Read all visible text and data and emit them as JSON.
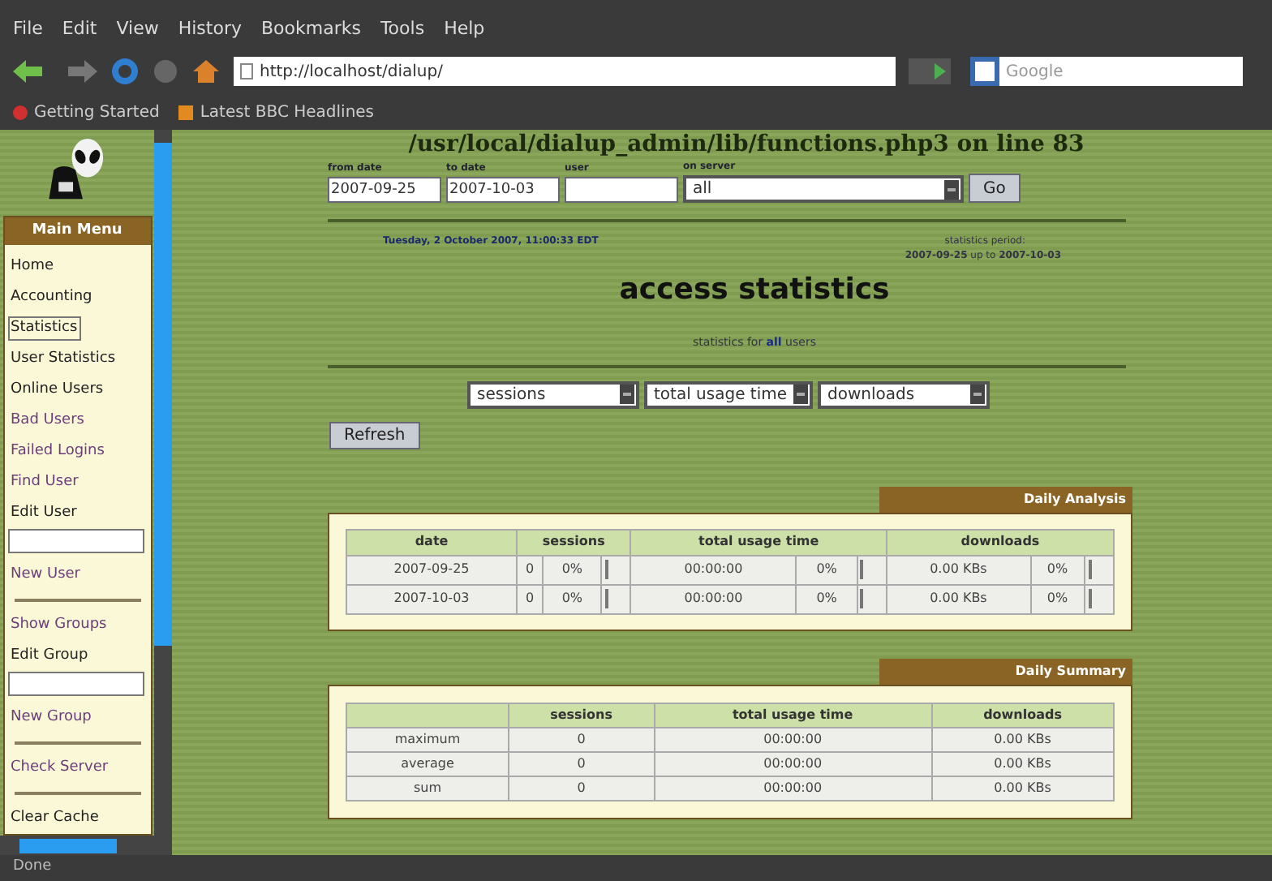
{
  "menu_bar": [
    "File",
    "Edit",
    "View",
    "History",
    "Bookmarks",
    "Tools",
    "Help"
  ],
  "address_bar": {
    "value": "http://localhost/dialup/"
  },
  "search_field": {
    "placeholder": "Google"
  },
  "bookmarks": [
    "Getting Started",
    "Latest BBC Headlines"
  ],
  "sidebar": {
    "title": "Main Menu",
    "items": [
      {
        "label": "Home",
        "kind": "link",
        "visited": false,
        "selected": false,
        "separator_after": false
      },
      {
        "label": "Accounting",
        "kind": "link",
        "visited": false,
        "selected": false,
        "separator_after": false
      },
      {
        "label": "Statistics",
        "kind": "link",
        "visited": false,
        "selected": true,
        "separator_after": false
      },
      {
        "label": "User Statistics",
        "kind": "link",
        "visited": false,
        "selected": false,
        "separator_after": false
      },
      {
        "label": "Online Users",
        "kind": "link",
        "visited": false,
        "selected": false,
        "separator_after": false
      },
      {
        "label": "Bad Users",
        "kind": "link",
        "visited": true,
        "selected": false,
        "separator_after": false
      },
      {
        "label": "Failed Logins",
        "kind": "link",
        "visited": true,
        "selected": false,
        "separator_after": false
      },
      {
        "label": "Find User",
        "kind": "link",
        "visited": true,
        "selected": false,
        "separator_after": false
      },
      {
        "label": "Edit User",
        "kind": "field",
        "visited": false,
        "selected": false,
        "separator_after": false
      },
      {
        "label": "New User",
        "kind": "link",
        "visited": true,
        "selected": false,
        "separator_after": true
      },
      {
        "label": "Show Groups",
        "kind": "link",
        "visited": true,
        "selected": false,
        "separator_after": false
      },
      {
        "label": "Edit Group",
        "kind": "field",
        "visited": false,
        "selected": false,
        "separator_after": false
      },
      {
        "label": "New Group",
        "kind": "link",
        "visited": true,
        "selected": false,
        "separator_after": true
      },
      {
        "label": "Check Server",
        "kind": "link",
        "visited": true,
        "selected": false,
        "separator_after": true
      },
      {
        "label": "Clear Cache",
        "kind": "link",
        "visited": false,
        "selected": false,
        "separator_after": false
      }
    ]
  },
  "error_line": "/usr/local/dialup_admin/lib/functions.php3 on line **83**",
  "filter_form": {
    "fields": [
      {
        "label": "from date",
        "kind": "text",
        "value": "2007-09-25"
      },
      {
        "label": "to date",
        "kind": "text",
        "value": "2007-10-03"
      },
      {
        "label": "user",
        "kind": "text"
      },
      {
        "label": "on server",
        "kind": "select",
        "value": "all"
      }
    ],
    "button": "Go"
  },
  "timestamp": "Tuesday, 2 October 2007, 11:00:33 EDT",
  "period": {
    "label": "statistics period:",
    "range": "**2007-09-25** up to **2007-10-03**"
  },
  "heading": "access statistics",
  "subtitle": "statistics for **all** users",
  "selectors": [
    "sessions",
    "total usage time",
    "downloads"
  ],
  "refresh_button": "Refresh",
  "daily_analysis": {
    "title": "Daily Analysis",
    "column_groups": [
      "date",
      "sessions",
      "total usage time",
      "downloads"
    ],
    "rows": [
      {
        "date": "2007-09-25",
        "cells": [
          {
            "value": "0",
            "percent": "0%"
          },
          {
            "value": "00:00:00",
            "percent": "0%"
          },
          {
            "value": "0.00 KBs",
            "percent": "0%"
          }
        ]
      },
      {
        "date": "2007-10-03",
        "cells": [
          {
            "value": "0",
            "percent": "0%"
          },
          {
            "value": "00:00:00",
            "percent": "0%"
          },
          {
            "value": "0.00 KBs",
            "percent": "0%"
          }
        ]
      }
    ]
  },
  "daily_summary": {
    "title": "Daily Summary",
    "columns": [
      "sessions",
      "total usage time",
      "downloads"
    ],
    "rows": [
      {
        "label": "maximum",
        "values": [
          "0",
          "00:00:00",
          "0.00 KBs"
        ]
      },
      {
        "label": "average",
        "values": [
          "0",
          "00:00:00",
          "0.00 KBs"
        ]
      },
      {
        "label": "sum",
        "values": [
          "0",
          "00:00:00",
          "0.00 KBs"
        ]
      }
    ]
  },
  "status_bar": "Done"
}
